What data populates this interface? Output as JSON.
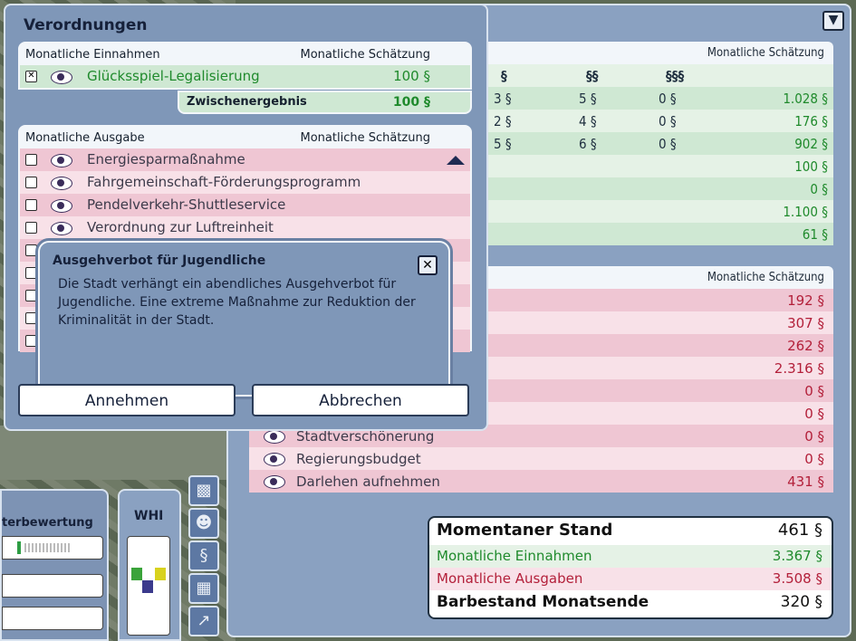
{
  "budget": {
    "income_header": "Monatliche Schätzung",
    "tier_labels": [
      "§",
      "§§",
      "§§§"
    ],
    "income_rows": [
      {
        "c0": "3 §",
        "c1": "5 §",
        "c2": "0 §",
        "value": "1.028 §"
      },
      {
        "c0": "2 §",
        "c1": "4 §",
        "c2": "0 §",
        "value": "176 §"
      },
      {
        "c0": "5 §",
        "c1": "6 §",
        "c2": "0 §",
        "value": "902 §"
      },
      {
        "c0": "",
        "c1": "",
        "c2": "",
        "value": "100 §"
      },
      {
        "c0": "",
        "c1": "",
        "c2": "",
        "value": "0 §"
      },
      {
        "c0": "",
        "c1": "",
        "c2": "",
        "value": "1.100 §"
      },
      {
        "c0": "",
        "c1": "",
        "c2": "",
        "value": "61 §"
      }
    ],
    "expense_header": "Monatliche Schätzung",
    "expense_rows": [
      {
        "label": "",
        "value": "192 §"
      },
      {
        "label": "",
        "value": "307 §"
      },
      {
        "label": "",
        "value": "262 §"
      },
      {
        "label": "",
        "value": "2.316 §"
      },
      {
        "label": "",
        "value": "0 §"
      },
      {
        "label": "",
        "value": "0 §"
      },
      {
        "label": "Stadtverschönerung",
        "value": "0 §"
      },
      {
        "label": "Regierungsbudget",
        "value": "0 §"
      },
      {
        "label": "Darlehen aufnehmen",
        "value": "431 §"
      }
    ],
    "summary": {
      "current_label": "Momentaner Stand",
      "current_value": "461 §",
      "income_label": "Monatliche Einnahmen",
      "income_value": "3.367 §",
      "expense_label": "Monatliche Ausgaben",
      "expense_value": "3.508 §",
      "end_label": "Barbestand Monatsende",
      "end_value": "320 §"
    }
  },
  "left": {
    "rating_label": "terbewertung",
    "whi_label": "WHI"
  },
  "ordinances": {
    "title": "Verordnungen",
    "income_section": {
      "header": "Monatliche Einnahmen",
      "estimate_header": "Monatliche Schätzung",
      "items": [
        {
          "label": "Glücksspiel-Legalisierung",
          "value": "100 §",
          "checked": true
        }
      ],
      "subtotal_label": "Zwischenergebnis",
      "subtotal_value": "100 §"
    },
    "expense_section": {
      "header": "Monatliche Ausgabe",
      "estimate_header": "Monatliche Schätzung",
      "items": [
        {
          "label": "Energiesparmaßnahme"
        },
        {
          "label": "Fahrgemeinschaft-Förderungsprogramm"
        },
        {
          "label": "Pendelverkehr-Shuttleservice"
        },
        {
          "label": "Verordnung zur Luftreinheit"
        }
      ]
    }
  },
  "dialog": {
    "title": "Ausgehverbot für Jugendliche",
    "body": "Die Stadt verhängt ein abendliches Ausgehverbot für Jugendliche. Eine extreme Maßnahme zur Reduktion der Kriminalität in der Stadt.",
    "accept": "Annehmen",
    "cancel": "Abbrechen"
  }
}
